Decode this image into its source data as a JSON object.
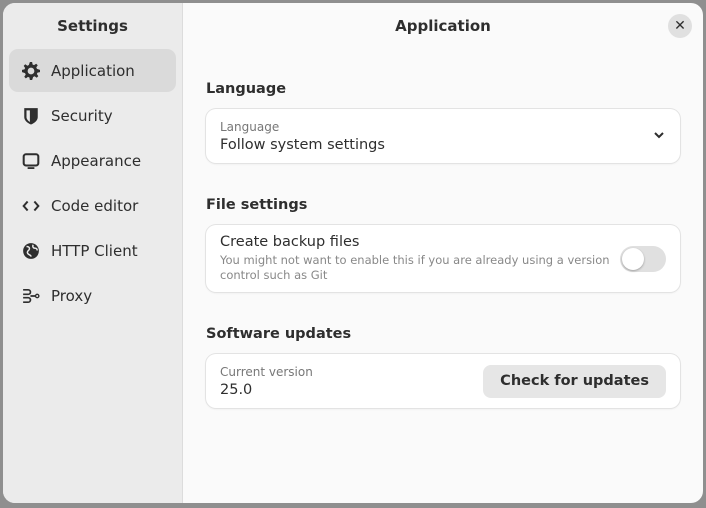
{
  "sidebar": {
    "title": "Settings",
    "items": [
      {
        "label": "Application",
        "icon": "gear-icon",
        "active": true
      },
      {
        "label": "Security",
        "icon": "shield-icon"
      },
      {
        "label": "Appearance",
        "icon": "monitor-icon"
      },
      {
        "label": "Code editor",
        "icon": "code-icon"
      },
      {
        "label": "HTTP Client",
        "icon": "globe-icon"
      },
      {
        "label": "Proxy",
        "icon": "proxy-icon"
      }
    ]
  },
  "main": {
    "title": "Application",
    "close_icon": "close-icon",
    "language": {
      "section": "Language",
      "label": "Language",
      "value": "Follow system settings"
    },
    "file_settings": {
      "section": "File settings",
      "title": "Create backup files",
      "description": "You might not want to enable this if you are already using a version control such as Git",
      "enabled": false
    },
    "updates": {
      "section": "Software updates",
      "label": "Current version",
      "version": "25.0",
      "button": "Check for updates"
    }
  }
}
